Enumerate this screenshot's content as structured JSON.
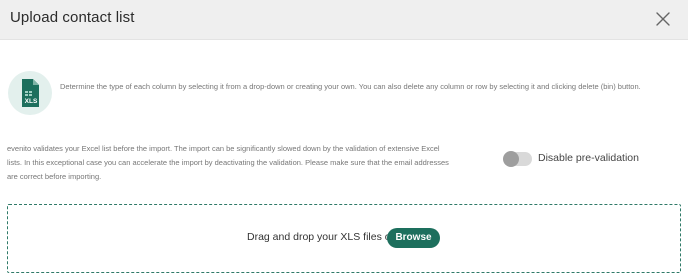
{
  "dialog": {
    "title": "Upload contact list"
  },
  "info": {
    "icon_label": "XLS",
    "text": "Determine the type of each column by selecting it from a drop-down or creating your own. You can also delete any column or row by selecting it and clicking delete (bin) button."
  },
  "validation": {
    "text": "evenito validates your Excel list before the import. The import can be significantly slowed down by the validation of extensive Excel lists. In this exceptional case you can accelerate the import by deactivating the validation. Please make sure that the email addresses are correct before importing.",
    "toggle_label": "Disable pre-validation",
    "toggle_on": false
  },
  "dropzone": {
    "text": "Drag and drop your XLS files or",
    "browse_label": "Browse"
  },
  "colors": {
    "accent": "#1d6f5d",
    "header_bg": "#efefef",
    "icon_bg": "#e3f0ed"
  }
}
